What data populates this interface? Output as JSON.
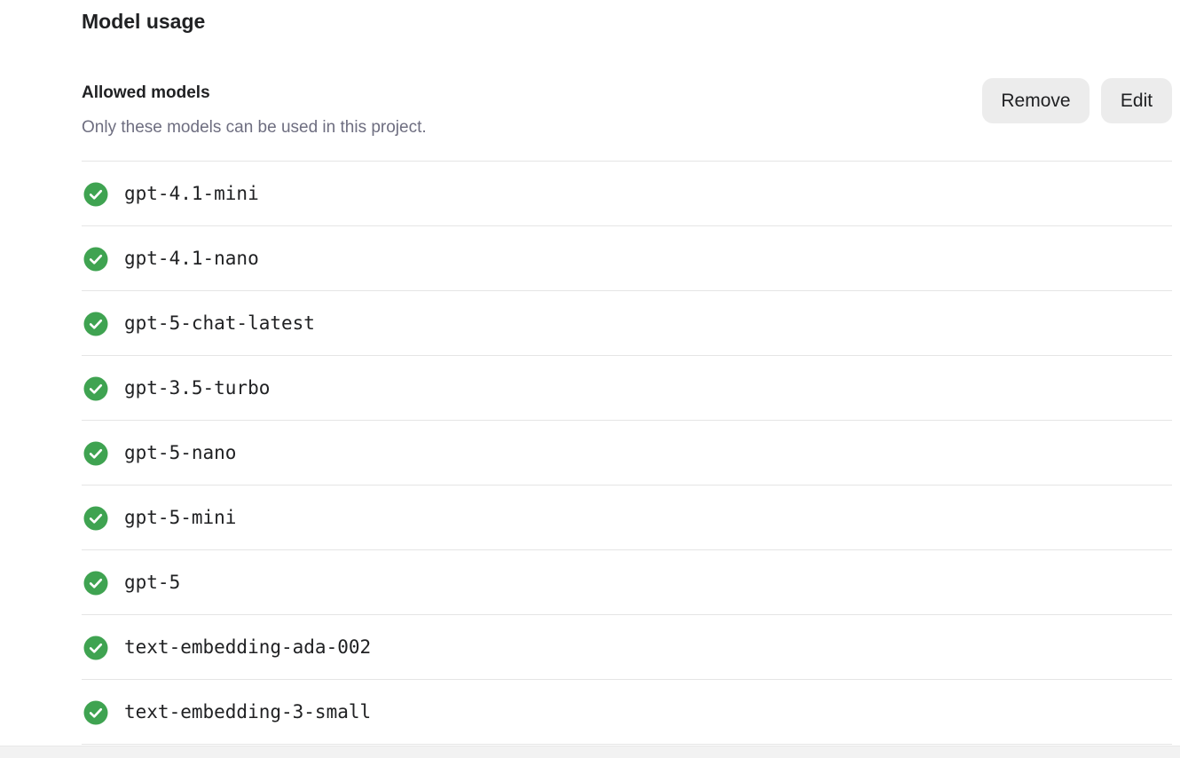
{
  "section": {
    "title": "Model usage"
  },
  "allowed": {
    "title": "Allowed models",
    "description": "Only these models can be used in this project.",
    "remove_label": "Remove",
    "edit_label": "Edit"
  },
  "models": [
    "gpt-4.1-mini",
    "gpt-4.1-nano",
    "gpt-5-chat-latest",
    "gpt-3.5-turbo",
    "gpt-5-nano",
    "gpt-5-mini",
    "gpt-5",
    "text-embedding-ada-002",
    "text-embedding-3-small"
  ],
  "colors": {
    "check_green": "#3fa351",
    "divider": "#e5e5e5",
    "button_bg": "#ececec"
  },
  "icons": {
    "model_status": "check-circle-icon"
  }
}
